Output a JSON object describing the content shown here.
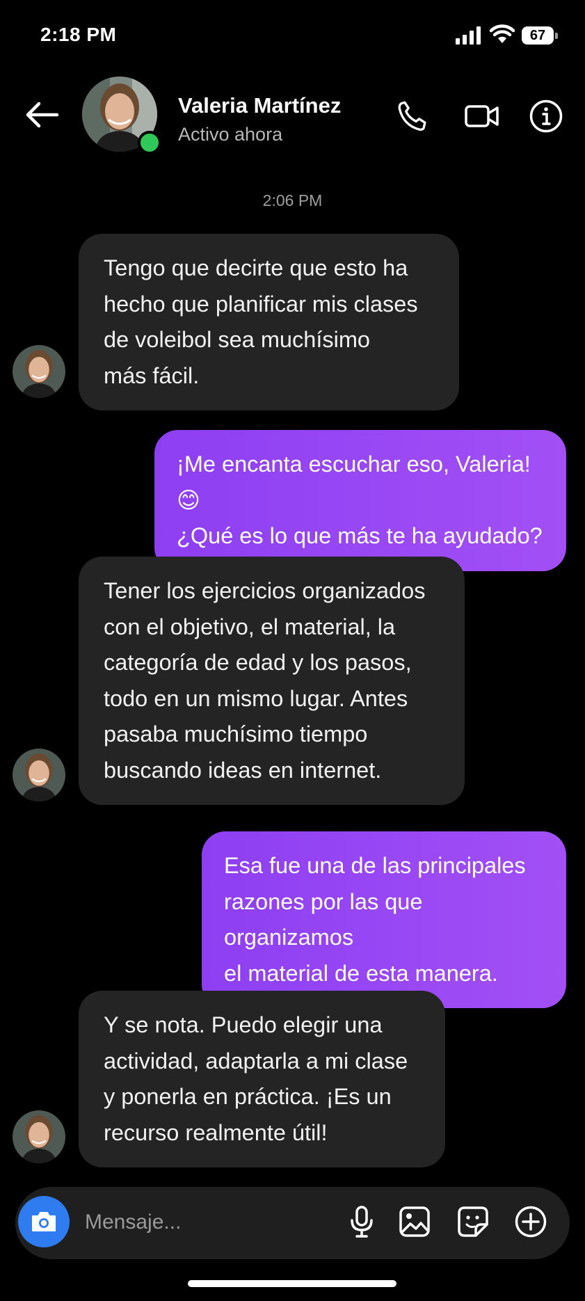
{
  "status_bar": {
    "time": "2:18 PM",
    "battery": "67"
  },
  "header": {
    "contact_name": "Valeria Martínez",
    "contact_status": "Activo ahora",
    "icons": [
      "back-arrow-icon",
      "phone-icon",
      "video-camera-icon",
      "info-icon"
    ],
    "online_color": "#31c85a"
  },
  "chat": {
    "timestamp": "2:06 PM",
    "messages": [
      {
        "from": "contact",
        "lines": [
          "Tengo que decirte que esto ha",
          "hecho que planificar mis clases",
          "de voleibol sea muchísimo",
          "más fácil."
        ]
      },
      {
        "from": "me",
        "lines": [
          "¡Me encanta escuchar eso, Valeria! 😊",
          "¿Qué es lo que más te ha ayudado?"
        ]
      },
      {
        "from": "contact",
        "lines": [
          "Tener los ejercicios organizados",
          "con el objetivo, el material, la",
          "categoría de edad y los pasos,",
          "todo en un mismo lugar. Antes",
          "pasaba muchísimo tiempo",
          "buscando ideas en internet."
        ]
      },
      {
        "from": "me",
        "lines": [
          "Esa fue una de las principales",
          "razones por las que organizamos",
          "el material de esta manera."
        ]
      },
      {
        "from": "contact",
        "lines": [
          "Y se nota. Puedo elegir una",
          "actividad, adaptarla a mi clase",
          "y ponerla en práctica. ¡Es un",
          "recurso realmente útil!"
        ]
      }
    ]
  },
  "composer": {
    "placeholder": "Mensaje...",
    "icons": [
      "camera-icon",
      "microphone-icon",
      "image-icon",
      "sticker-icon",
      "add-circle-icon"
    ],
    "camera_color": "#2f7cf0"
  },
  "colors": {
    "background": "#000000",
    "incoming_bubble": "#242424",
    "outgoing_bubble_start": "#8d3ff2",
    "outgoing_bubble_end": "#a24ff5"
  }
}
